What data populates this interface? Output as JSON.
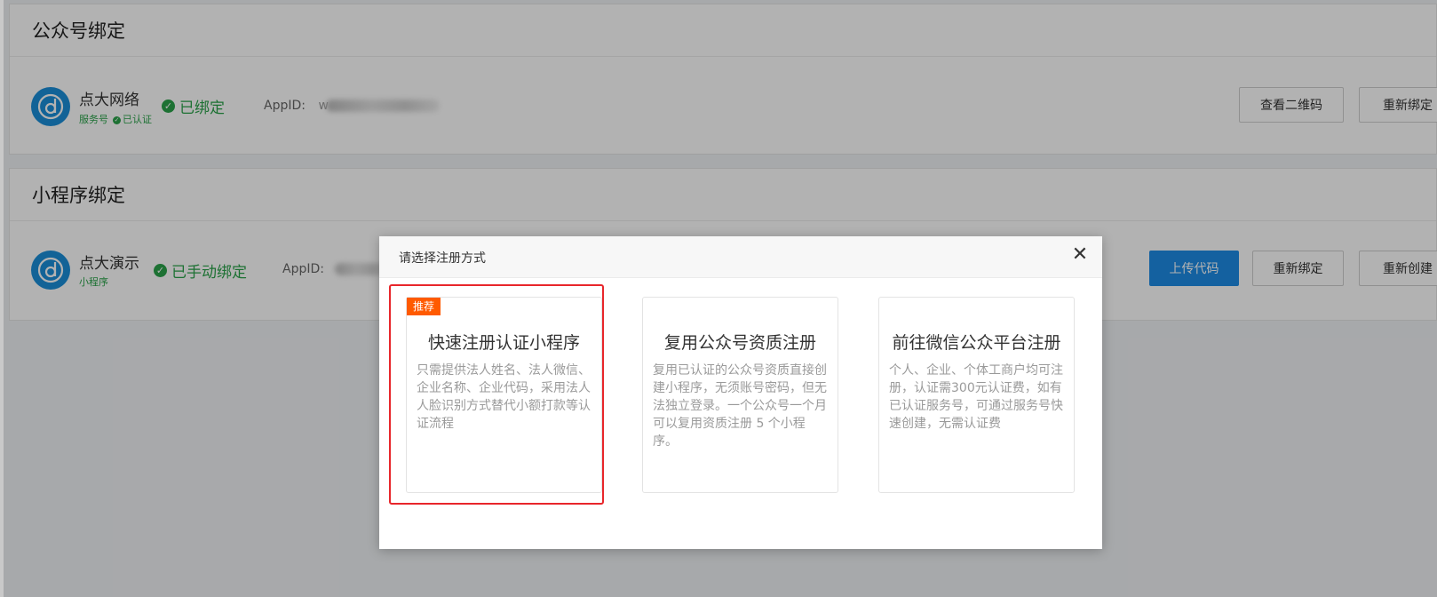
{
  "official_account": {
    "section_title": "公众号绑定",
    "name": "点大网络",
    "type": "服务号",
    "verified": "已认证",
    "status": "已绑定",
    "appid_label": "AppID:",
    "appid_visible": "w",
    "buttons": {
      "qrcode": "查看二维码",
      "rebind": "重新绑定"
    }
  },
  "mini_program": {
    "section_title": "小程序绑定",
    "name": "点大演示",
    "type": "小程序",
    "status": "已手动绑定",
    "appid_label": "AppID:",
    "buttons": {
      "upload": "上传代码",
      "rebind": "重新绑定",
      "recreate": "重新创建"
    }
  },
  "modal": {
    "title": "请选择注册方式",
    "close_icon": "close-icon",
    "options": [
      {
        "tag": "推荐",
        "title": "快速注册认证小程序",
        "desc": "只需提供法人姓名、法人微信、企业名称、企业代码，采用法人人脸识别方式替代小额打款等认证流程"
      },
      {
        "title": "复用公众号资质注册",
        "desc": "复用已认证的公众号资质直接创建小程序，无须账号密码，但无法独立登录。一个公众号一个月可以复用资质注册 5 个小程序。"
      },
      {
        "title": "前往微信公众平台注册",
        "desc": "个人、企业、个体工商户均可注册，认证需300元认证费，如有已认证服务号，可通过服务号快速创建，无需认证费"
      }
    ]
  },
  "colors": {
    "primary": "#1e8ce6",
    "success": "#2aa34a",
    "tag": "#ff5a00",
    "highlight": "#e8262b"
  }
}
